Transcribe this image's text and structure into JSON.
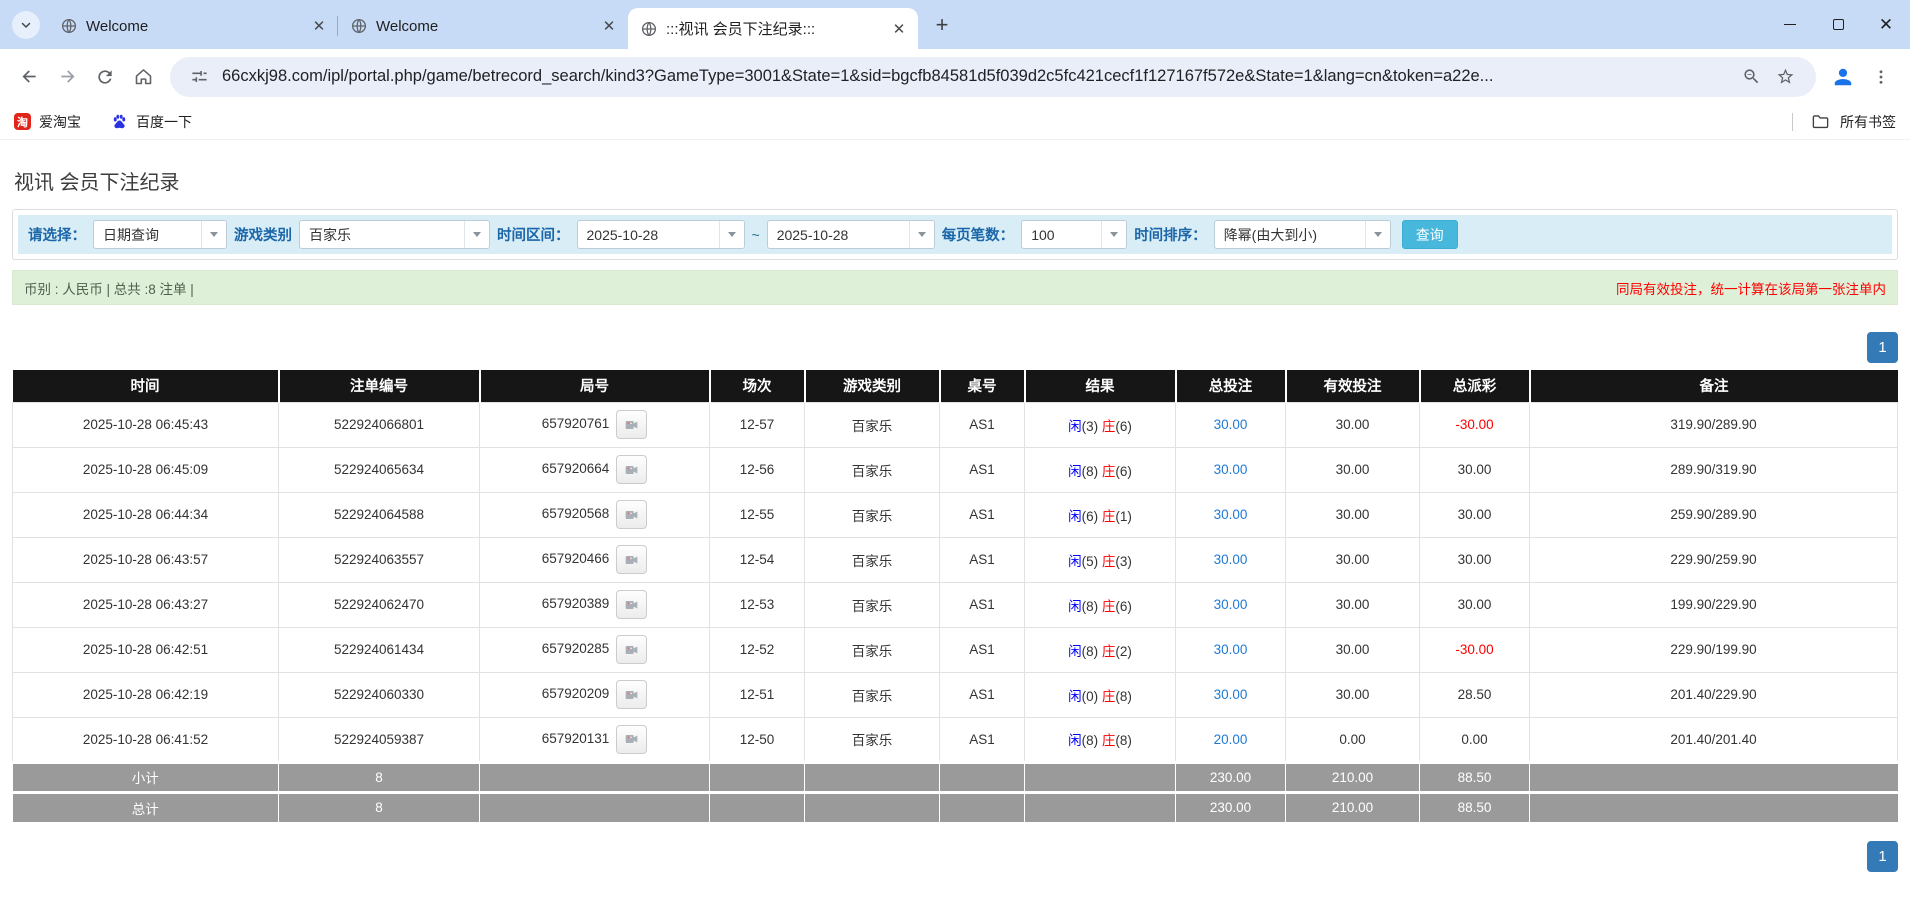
{
  "browser": {
    "tabs": [
      {
        "label": "Welcome"
      },
      {
        "label": "Welcome"
      },
      {
        "label": ":::视讯 会员下注纪录:::"
      }
    ],
    "url": "66cxkj98.com/ipl/portal.php/game/betrecord_search/kind3?GameType=3001&State=1&sid=bgcfb84581d5f039d2c5fc421cecf1f127167f572e&State=1&lang=cn&token=a22e...",
    "bookmarks": [
      {
        "label": "爱淘宝",
        "icon_text": "淘"
      },
      {
        "label": "百度一下"
      }
    ],
    "all_bookmarks_label": "所有书签"
  },
  "page": {
    "title": "视讯 会员下注纪录",
    "filters": {
      "select_label": "请选择：",
      "select_value": "日期查询",
      "game_type_label": "游戏类别",
      "game_type_value": "百家乐",
      "date_range_label": "时间区间：",
      "date_from": "2025-10-28",
      "tilde": "~",
      "date_to": "2025-10-28",
      "page_size_label": "每页笔数：",
      "page_size_value": "100",
      "sort_label": "时间排序：",
      "sort_value": "降幂(由大到小)",
      "search_button": "查询"
    },
    "summary": {
      "left": "币别 : 人民币 | 总共 :8 注单 |",
      "right": "同局有效投注，统一计算在该局第一张注单内"
    },
    "pagination": "1",
    "table": {
      "headers": [
        "时间",
        "注单编号",
        "局号",
        "场次",
        "游戏类别",
        "桌号",
        "结果",
        "总投注",
        "有效投注",
        "总派彩",
        "备注"
      ],
      "rows": [
        {
          "time": "2025-10-28 06:45:43",
          "bet_id": "522924066801",
          "round_id": "657920761",
          "session": "12-57",
          "game_type": "百家乐",
          "table_no": "AS1",
          "result": {
            "player": "闲",
            "player_score": "(3)",
            "banker": "庄",
            "banker_score": "(6)"
          },
          "total_bet": "30.00",
          "valid_bet": "30.00",
          "payout": "-30.00",
          "remark": "319.90/289.90"
        },
        {
          "time": "2025-10-28 06:45:09",
          "bet_id": "522924065634",
          "round_id": "657920664",
          "session": "12-56",
          "game_type": "百家乐",
          "table_no": "AS1",
          "result": {
            "player": "闲",
            "player_score": "(8)",
            "banker": "庄",
            "banker_score": "(6)"
          },
          "total_bet": "30.00",
          "valid_bet": "30.00",
          "payout": "30.00",
          "remark": "289.90/319.90"
        },
        {
          "time": "2025-10-28 06:44:34",
          "bet_id": "522924064588",
          "round_id": "657920568",
          "session": "12-55",
          "game_type": "百家乐",
          "table_no": "AS1",
          "result": {
            "player": "闲",
            "player_score": "(6)",
            "banker": "庄",
            "banker_score": "(1)"
          },
          "total_bet": "30.00",
          "valid_bet": "30.00",
          "payout": "30.00",
          "remark": "259.90/289.90"
        },
        {
          "time": "2025-10-28 06:43:57",
          "bet_id": "522924063557",
          "round_id": "657920466",
          "session": "12-54",
          "game_type": "百家乐",
          "table_no": "AS1",
          "result": {
            "player": "闲",
            "player_score": "(5)",
            "banker": "庄",
            "banker_score": "(3)"
          },
          "total_bet": "30.00",
          "valid_bet": "30.00",
          "payout": "30.00",
          "remark": "229.90/259.90"
        },
        {
          "time": "2025-10-28 06:43:27",
          "bet_id": "522924062470",
          "round_id": "657920389",
          "session": "12-53",
          "game_type": "百家乐",
          "table_no": "AS1",
          "result": {
            "player": "闲",
            "player_score": "(8)",
            "banker": "庄",
            "banker_score": "(6)"
          },
          "total_bet": "30.00",
          "valid_bet": "30.00",
          "payout": "30.00",
          "remark": "199.90/229.90"
        },
        {
          "time": "2025-10-28 06:42:51",
          "bet_id": "522924061434",
          "round_id": "657920285",
          "session": "12-52",
          "game_type": "百家乐",
          "table_no": "AS1",
          "result": {
            "player": "闲",
            "player_score": "(8)",
            "banker": "庄",
            "banker_score": "(2)"
          },
          "total_bet": "30.00",
          "valid_bet": "30.00",
          "payout": "-30.00",
          "remark": "229.90/199.90"
        },
        {
          "time": "2025-10-28 06:42:19",
          "bet_id": "522924060330",
          "round_id": "657920209",
          "session": "12-51",
          "game_type": "百家乐",
          "table_no": "AS1",
          "result": {
            "player": "闲",
            "player_score": "(0)",
            "banker": "庄",
            "banker_score": "(8)"
          },
          "total_bet": "30.00",
          "valid_bet": "30.00",
          "payout": "28.50",
          "remark": "201.40/229.90"
        },
        {
          "time": "2025-10-28 06:41:52",
          "bet_id": "522924059387",
          "round_id": "657920131",
          "session": "12-50",
          "game_type": "百家乐",
          "table_no": "AS1",
          "result": {
            "player": "闲",
            "player_score": "(8)",
            "banker": "庄",
            "banker_score": "(8)"
          },
          "total_bet": "20.00",
          "valid_bet": "0.00",
          "payout": "0.00",
          "remark": "201.40/201.40"
        }
      ],
      "subtotal": {
        "name": "subtotal-row",
        "label": "小计",
        "count": "8",
        "total_bet": "230.00",
        "valid_bet": "210.00",
        "payout": "88.50"
      },
      "total": {
        "name": "total-row",
        "label": "总计",
        "count": "8",
        "total_bet": "230.00",
        "valid_bet": "210.00",
        "payout": "88.50"
      }
    }
  }
}
